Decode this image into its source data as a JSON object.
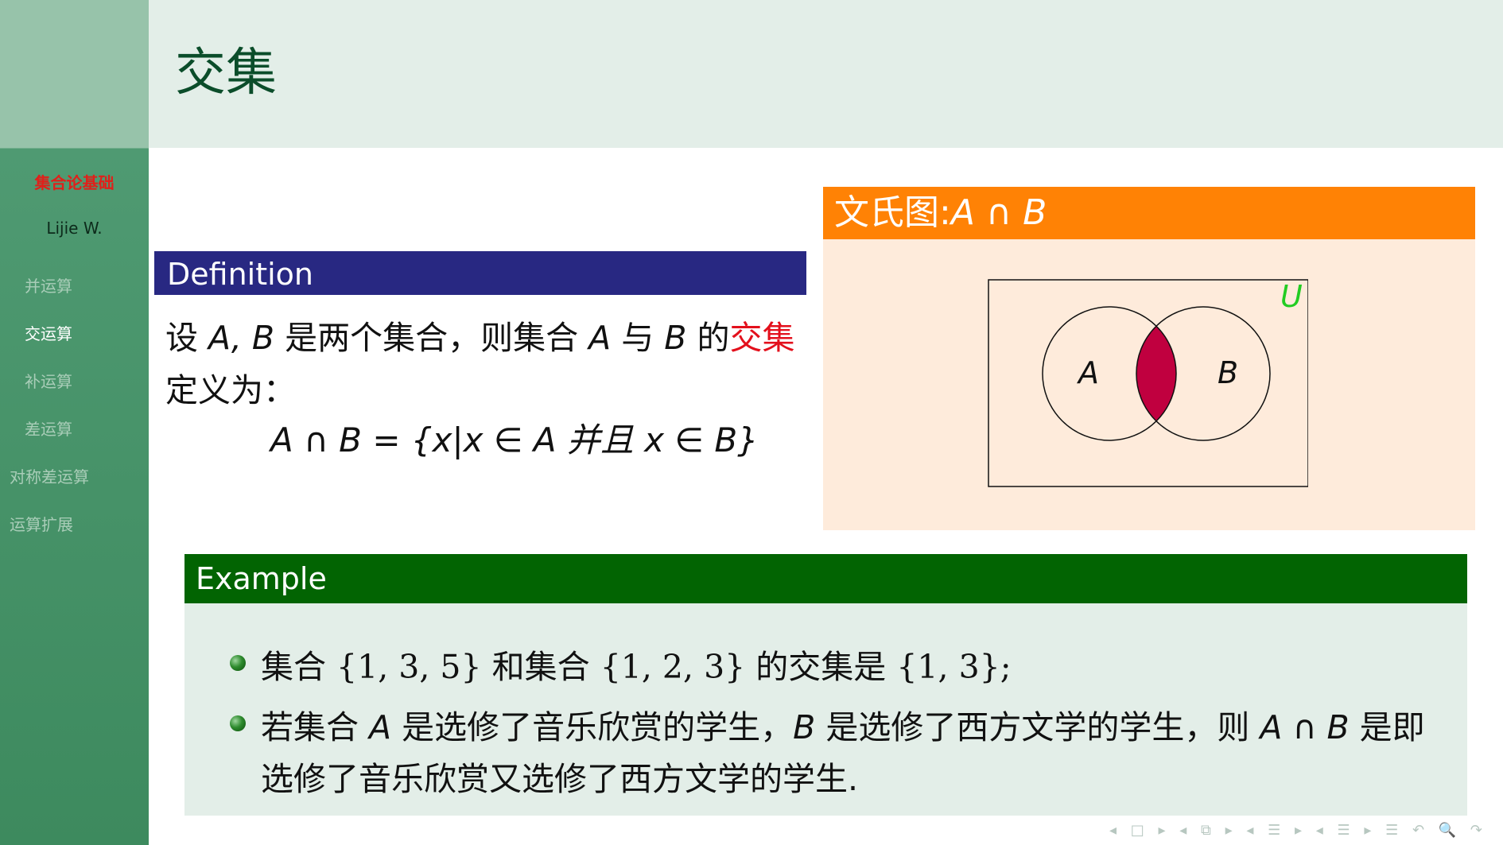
{
  "frame": {
    "title": "交集"
  },
  "sidebar": {
    "short_title": "集合论基础",
    "author": "Lijie W.",
    "nav": [
      "并运算",
      "交运算",
      "补运算",
      "差运算",
      "对称差运算",
      "运算扩展"
    ],
    "active_index": 1
  },
  "definition": {
    "title": "Definition",
    "text_a": "设 ",
    "var_ab": "A, B",
    "text_b": " 是两个集合，则集合 ",
    "var_a": "A",
    "text_c": " 与 ",
    "var_b": "B",
    "text_d": " 的",
    "highlight": "交集",
    "text_e": "定义为：",
    "formula": "A ∩ B = {x|x ∈ A 并且 x ∈ B}"
  },
  "venn": {
    "title_text": "文氏图:",
    "title_math": "A ∩ B",
    "label_a": "A",
    "label_b": "B",
    "label_u": "U",
    "colors": {
      "intersection": "#c0003f",
      "universe_label": "#22cc22"
    }
  },
  "example": {
    "title": "Example",
    "line1": {
      "t1": "集合 ",
      "m1": "{1, 3, 5}",
      "t2": " 和集合 ",
      "m2": "{1, 2, 3}",
      "t3": " 的交集是 ",
      "m3": "{1, 3};"
    },
    "line2": {
      "t1": "若集合 ",
      "m1": "A",
      "t2": " 是选修了音乐欣赏的学生，",
      "m2": "B",
      "t3": " 是选修了西方文学的学生，则 ",
      "m3": "A ∩ B",
      "t4": " 是即"
    },
    "line3": "选修了音乐欣赏又选修了西方文学的学生."
  },
  "navigation_symbols": "◂ □ ▸ ◂ ⧉ ▸ ◂ ☰ ▸ ◂ ☰ ▸ ☰ ↶ 🔍 ↷"
}
